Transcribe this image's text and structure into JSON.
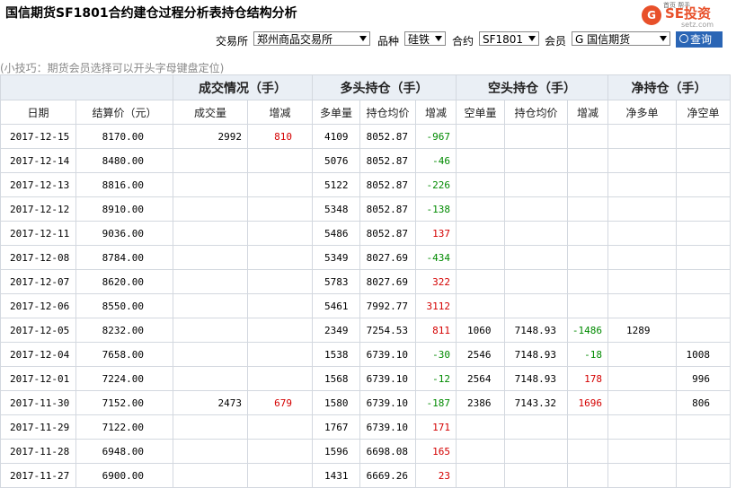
{
  "title": "国信期货SF1801合约建仓过程分析表持仓结构分析",
  "logo": {
    "mark": "G",
    "brand": "SE投资",
    "sub": "setz.com",
    "faint": "首页  帮手"
  },
  "filters": {
    "exchange_label": "交易所",
    "exchange_value": "郑州商品交易所",
    "variety_label": "品种",
    "variety_value": "硅铁",
    "contract_label": "合约",
    "contract_value": "SF1801",
    "member_label": "会员",
    "member_value": "G 国信期货",
    "query_label": "查询"
  },
  "tip": "(小技巧：期货会员选择可以开头字母键盘定位)",
  "groups": {
    "trade": "成交情况（手）",
    "long": "多头持仓（手）",
    "short": "空头持仓（手）",
    "net": "净持仓（手）"
  },
  "columns": {
    "date": "日期",
    "price": "结算价（元）",
    "vol": "成交量",
    "vol_chg": "增减",
    "long": "多单量",
    "long_avg": "持仓均价",
    "long_chg": "增减",
    "short": "空单量",
    "short_avg": "持仓均价",
    "short_chg": "增减",
    "net_long": "净多单",
    "net_short": "净空单"
  },
  "rows": [
    {
      "date": "2017-12-15",
      "price": "8170.00",
      "vol": "2992",
      "vol_chg": "810",
      "long": "4109",
      "long_avg": "8052.87",
      "long_chg": "-967",
      "short": "",
      "short_avg": "",
      "short_chg": "",
      "net_long": "",
      "net_short": ""
    },
    {
      "date": "2017-12-14",
      "price": "8480.00",
      "vol": "",
      "vol_chg": "",
      "long": "5076",
      "long_avg": "8052.87",
      "long_chg": "-46",
      "short": "",
      "short_avg": "",
      "short_chg": "",
      "net_long": "",
      "net_short": ""
    },
    {
      "date": "2017-12-13",
      "price": "8816.00",
      "vol": "",
      "vol_chg": "",
      "long": "5122",
      "long_avg": "8052.87",
      "long_chg": "-226",
      "short": "",
      "short_avg": "",
      "short_chg": "",
      "net_long": "",
      "net_short": ""
    },
    {
      "date": "2017-12-12",
      "price": "8910.00",
      "vol": "",
      "vol_chg": "",
      "long": "5348",
      "long_avg": "8052.87",
      "long_chg": "-138",
      "short": "",
      "short_avg": "",
      "short_chg": "",
      "net_long": "",
      "net_short": ""
    },
    {
      "date": "2017-12-11",
      "price": "9036.00",
      "vol": "",
      "vol_chg": "",
      "long": "5486",
      "long_avg": "8052.87",
      "long_chg": "137",
      "short": "",
      "short_avg": "",
      "short_chg": "",
      "net_long": "",
      "net_short": ""
    },
    {
      "date": "2017-12-08",
      "price": "8784.00",
      "vol": "",
      "vol_chg": "",
      "long": "5349",
      "long_avg": "8027.69",
      "long_chg": "-434",
      "short": "",
      "short_avg": "",
      "short_chg": "",
      "net_long": "",
      "net_short": ""
    },
    {
      "date": "2017-12-07",
      "price": "8620.00",
      "vol": "",
      "vol_chg": "",
      "long": "5783",
      "long_avg": "8027.69",
      "long_chg": "322",
      "short": "",
      "short_avg": "",
      "short_chg": "",
      "net_long": "",
      "net_short": ""
    },
    {
      "date": "2017-12-06",
      "price": "8550.00",
      "vol": "",
      "vol_chg": "",
      "long": "5461",
      "long_avg": "7992.77",
      "long_chg": "3112",
      "short": "",
      "short_avg": "",
      "short_chg": "",
      "net_long": "",
      "net_short": ""
    },
    {
      "date": "2017-12-05",
      "price": "8232.00",
      "vol": "",
      "vol_chg": "",
      "long": "2349",
      "long_avg": "7254.53",
      "long_chg": "811",
      "short": "1060",
      "short_avg": "7148.93",
      "short_chg": "-1486",
      "net_long": "1289",
      "net_short": ""
    },
    {
      "date": "2017-12-04",
      "price": "7658.00",
      "vol": "",
      "vol_chg": "",
      "long": "1538",
      "long_avg": "6739.10",
      "long_chg": "-30",
      "short": "2546",
      "short_avg": "7148.93",
      "short_chg": "-18",
      "net_long": "",
      "net_short": "1008"
    },
    {
      "date": "2017-12-01",
      "price": "7224.00",
      "vol": "",
      "vol_chg": "",
      "long": "1568",
      "long_avg": "6739.10",
      "long_chg": "-12",
      "short": "2564",
      "short_avg": "7148.93",
      "short_chg": "178",
      "net_long": "",
      "net_short": "996"
    },
    {
      "date": "2017-11-30",
      "price": "7152.00",
      "vol": "2473",
      "vol_chg": "679",
      "long": "1580",
      "long_avg": "6739.10",
      "long_chg": "-187",
      "short": "2386",
      "short_avg": "7143.32",
      "short_chg": "1696",
      "net_long": "",
      "net_short": "806"
    },
    {
      "date": "2017-11-29",
      "price": "7122.00",
      "vol": "",
      "vol_chg": "",
      "long": "1767",
      "long_avg": "6739.10",
      "long_chg": "171",
      "short": "",
      "short_avg": "",
      "short_chg": "",
      "net_long": "",
      "net_short": ""
    },
    {
      "date": "2017-11-28",
      "price": "6948.00",
      "vol": "",
      "vol_chg": "",
      "long": "1596",
      "long_avg": "6698.08",
      "long_chg": "165",
      "short": "",
      "short_avg": "",
      "short_chg": "",
      "net_long": "",
      "net_short": ""
    },
    {
      "date": "2017-11-27",
      "price": "6900.00",
      "vol": "",
      "vol_chg": "",
      "long": "1431",
      "long_avg": "6669.26",
      "long_chg": "23",
      "short": "",
      "short_avg": "",
      "short_chg": "",
      "net_long": "",
      "net_short": ""
    }
  ]
}
